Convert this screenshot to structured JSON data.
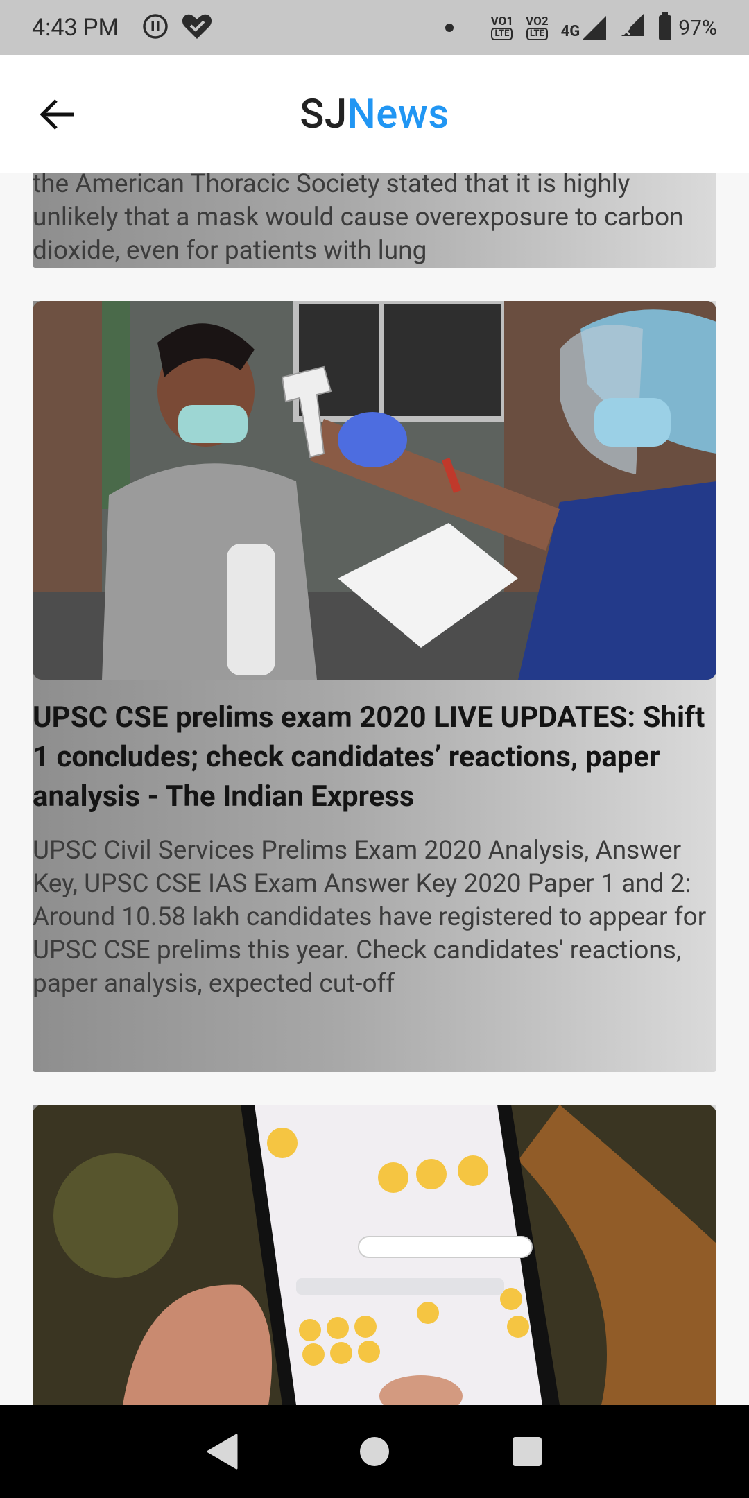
{
  "status_bar": {
    "time": "4:43 PM",
    "volte1": "VO",
    "volte1_sup": "1",
    "volte2": "VO",
    "volte2_sup": "2",
    "lte": "LTE",
    "network": "4G",
    "battery": "97%",
    "icons": [
      "pause-circle-icon",
      "heart-check-icon",
      "notification-dot-icon",
      "signal-4g-icon",
      "signal-no-service-icon",
      "battery-icon"
    ]
  },
  "app_bar": {
    "title_part1": "SJ",
    "title_part2": "News",
    "back_icon": "arrow-left-icon",
    "title_accent_color": "#2196f3"
  },
  "articles": {
    "previous": {
      "description": "the American Thoracic Society stated that it is highly unlikely that a mask would cause overexposure to carbon dioxide, even for patients with lung"
    },
    "main": {
      "image_alt": "Health worker checking a student's temperature with a thermometer gun",
      "title": "UPSC CSE prelims exam 2020 LIVE UPDATES: Shift 1 concludes; check candidates’ reactions, paper analysis - The Indian Express",
      "description": "UPSC Civil Services Prelims Exam 2020 Analysis, Answer Key, UPSC CSE IAS Exam Answer Key 2020 Paper 1 and 2: Around 10.58 lakh candidates have registered to appear for UPSC CSE prelims this year. Check candidates' reactions, paper analysis, expected cut-off"
    },
    "next": {
      "image_alt": "Hand holding a smartphone showing mask emoji on keyboard"
    }
  },
  "nav_bar": {
    "icons": [
      "back-triangle-icon",
      "home-circle-icon",
      "recents-square-icon"
    ]
  }
}
